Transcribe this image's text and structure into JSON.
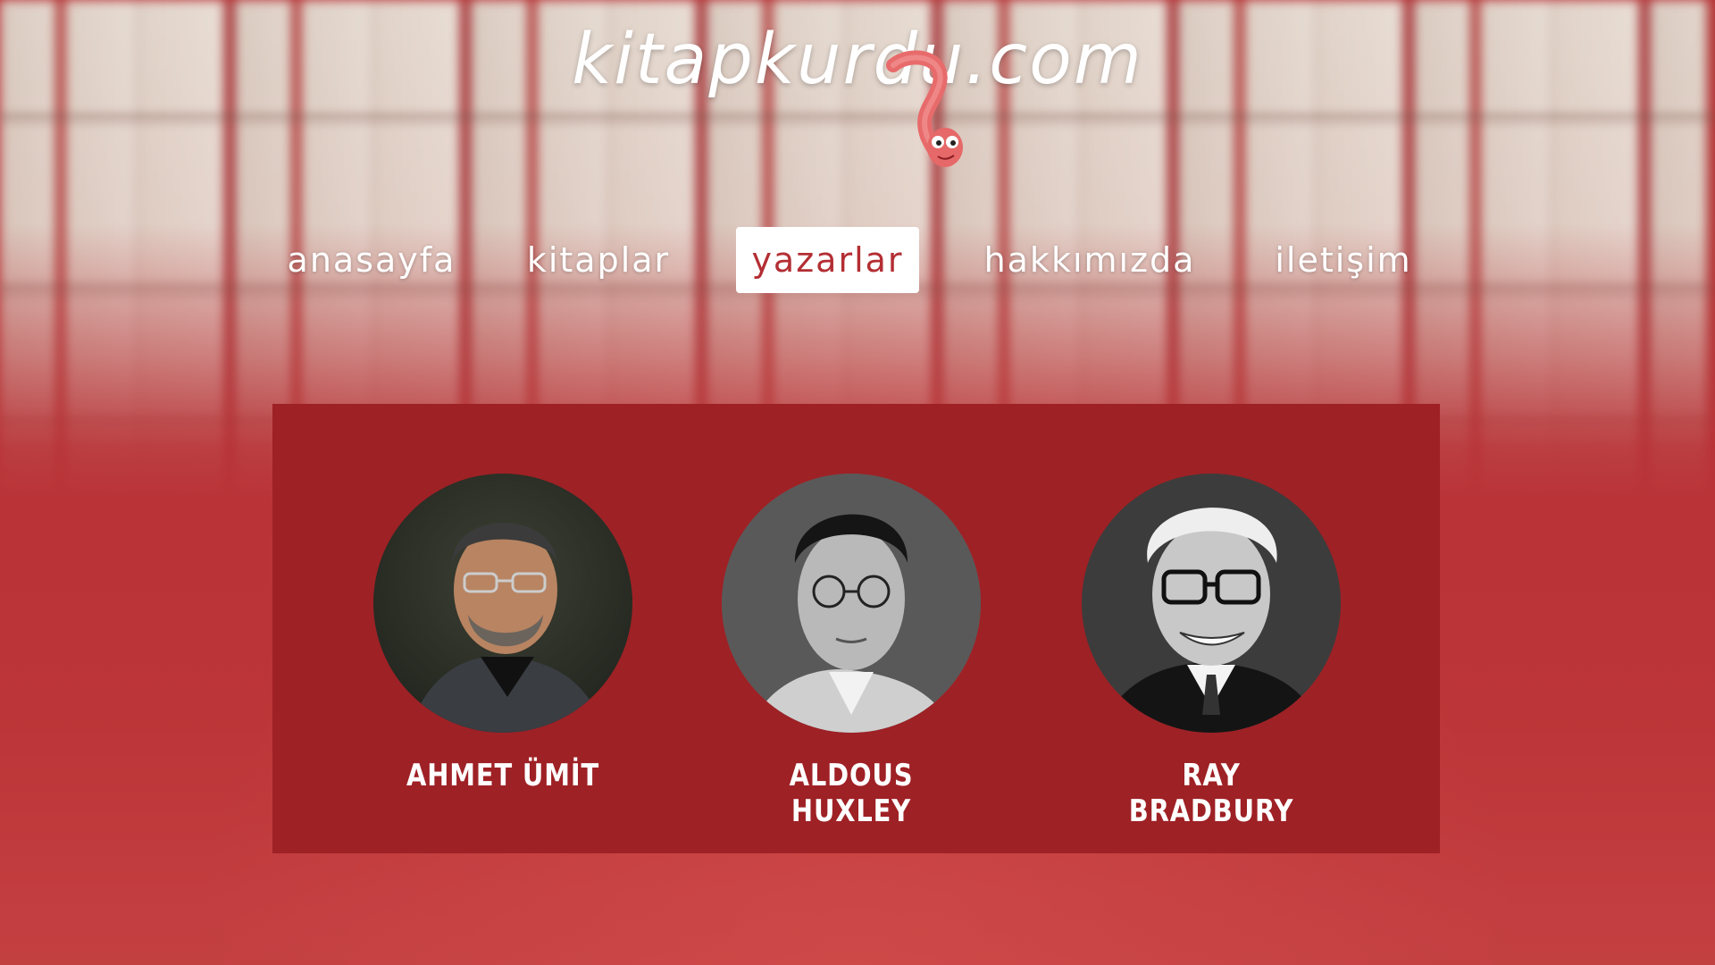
{
  "site": {
    "logo_text": "kitapkurdu.com"
  },
  "nav": {
    "items": [
      {
        "label": "anasayfa",
        "active": false
      },
      {
        "label": "kitaplar",
        "active": false
      },
      {
        "label": "yazarlar",
        "active": true
      },
      {
        "label": "hakkımızda",
        "active": false
      },
      {
        "label": "iletişim",
        "active": false
      }
    ]
  },
  "authors": [
    {
      "name": "AHMET ÜMİT"
    },
    {
      "name": "ALDOUS HUXLEY"
    },
    {
      "name": "RAY BRADBURY"
    }
  ],
  "colors": {
    "accent": "#b32e33",
    "panel": "#9e2125",
    "background": "#bc3538"
  },
  "icons": {
    "logo_mascot": "bookworm-icon"
  }
}
